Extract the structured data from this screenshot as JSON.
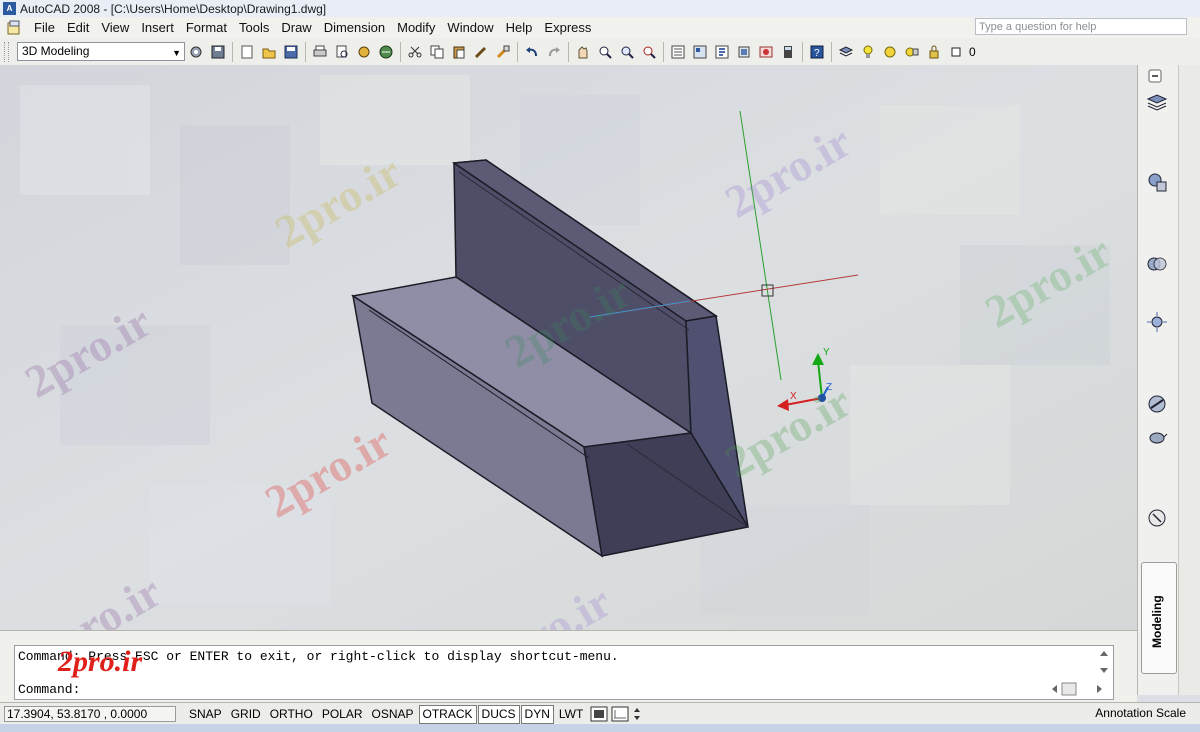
{
  "window": {
    "title": "AutoCAD 2008 - [C:\\Users\\Home\\Desktop\\Drawing1.dwg]",
    "app_icon": "autocad-logo-icon"
  },
  "menubar": {
    "items": [
      "File",
      "Edit",
      "View",
      "Insert",
      "Format",
      "Tools",
      "Draw",
      "Dimension",
      "Modify",
      "Window",
      "Help",
      "Express"
    ],
    "help_placeholder": "Type a question for help"
  },
  "toolbar": {
    "workspace": "3D Modeling",
    "layer_value": "0",
    "icons": [
      "workspace-settings-icon",
      "workspace-save-icon",
      "new-icon",
      "open-icon",
      "save-icon",
      "plot-icon",
      "plot-preview-icon",
      "publish-icon",
      "3d-dwf-icon",
      "cut-icon",
      "copy-icon",
      "paste-icon",
      "match-properties-icon",
      "block-editor-icon",
      "undo-icon",
      "redo-icon",
      "pan-icon",
      "zoom-realtime-icon",
      "zoom-window-icon",
      "zoom-previous-icon",
      "properties-icon",
      "design-center-icon",
      "tool-palettes-icon",
      "sheet-set-icon",
      "markup-icon",
      "quickcalc-icon",
      "help-icon",
      "layer-manager-icon"
    ]
  },
  "watermark": {
    "text": "2pro.ir"
  },
  "ucs": {
    "x": "X",
    "y": "Y",
    "z": "Z"
  },
  "command": {
    "line1": "Command: Press ESC or ENTER to exit, or right-click to display shortcut-menu.",
    "line2": "Command:"
  },
  "status": {
    "coords": "17.3904, 53.8170 , 0.0000",
    "buttons": [
      {
        "label": "SNAP",
        "on": false
      },
      {
        "label": "GRID",
        "on": false
      },
      {
        "label": "ORTHO",
        "on": false
      },
      {
        "label": "POLAR",
        "on": false
      },
      {
        "label": "OSNAP",
        "on": false
      },
      {
        "label": "OTRACK",
        "on": true
      },
      {
        "label": "DUCS",
        "on": true
      },
      {
        "label": "DYN",
        "on": true
      },
      {
        "label": "LWT",
        "on": false
      }
    ],
    "annotation_scale": "Annotation Scale"
  },
  "dashboard": {
    "tab_label": "Modeling"
  },
  "colors": {
    "solid_front": "#78788e",
    "solid_top": "#8f8ea6",
    "solid_back": "#4d4c66",
    "axis_x": "#d42020",
    "axis_y": "#14a814",
    "crosshair_red": "#b43a3a",
    "crosshair_green": "#2aa02a",
    "watermark_red": "#e0201a"
  }
}
